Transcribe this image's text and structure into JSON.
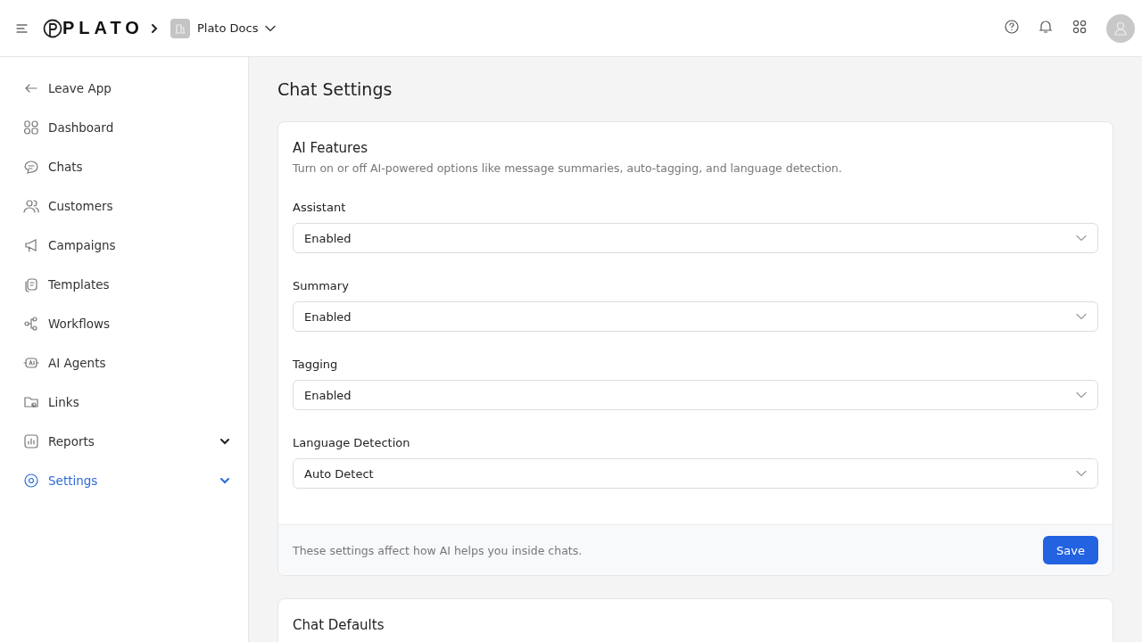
{
  "topbar": {
    "logo": "PLATO",
    "workspace": "Plato Docs"
  },
  "sidebar": {
    "items": [
      {
        "label": "Leave App",
        "selected": false,
        "submenu": false
      },
      {
        "label": "Dashboard",
        "selected": false,
        "submenu": false
      },
      {
        "label": "Chats",
        "selected": false,
        "submenu": false
      },
      {
        "label": "Customers",
        "selected": false,
        "submenu": false
      },
      {
        "label": "Campaigns",
        "selected": false,
        "submenu": false
      },
      {
        "label": "Templates",
        "selected": false,
        "submenu": false
      },
      {
        "label": "Workflows",
        "selected": false,
        "submenu": false
      },
      {
        "label": "AI Agents",
        "selected": false,
        "submenu": false
      },
      {
        "label": "Links",
        "selected": false,
        "submenu": false
      },
      {
        "label": "Reports",
        "selected": false,
        "submenu": true
      },
      {
        "label": "Settings",
        "selected": true,
        "submenu": true
      }
    ]
  },
  "page": {
    "title": "Chat Settings",
    "cards": [
      {
        "title": "AI Features",
        "description": "Turn on or off AI-powered options like message summaries, auto-tagging, and language detection.",
        "fields": [
          {
            "label": "Assistant",
            "value": "Enabled"
          },
          {
            "label": "Summary",
            "value": "Enabled"
          },
          {
            "label": "Tagging",
            "value": "Enabled"
          },
          {
            "label": "Language Detection",
            "value": "Auto Detect"
          }
        ],
        "footer": {
          "note": "These settings affect how AI helps you inside chats.",
          "button": "Save"
        }
      },
      {
        "title": "Chat Defaults"
      }
    ]
  }
}
